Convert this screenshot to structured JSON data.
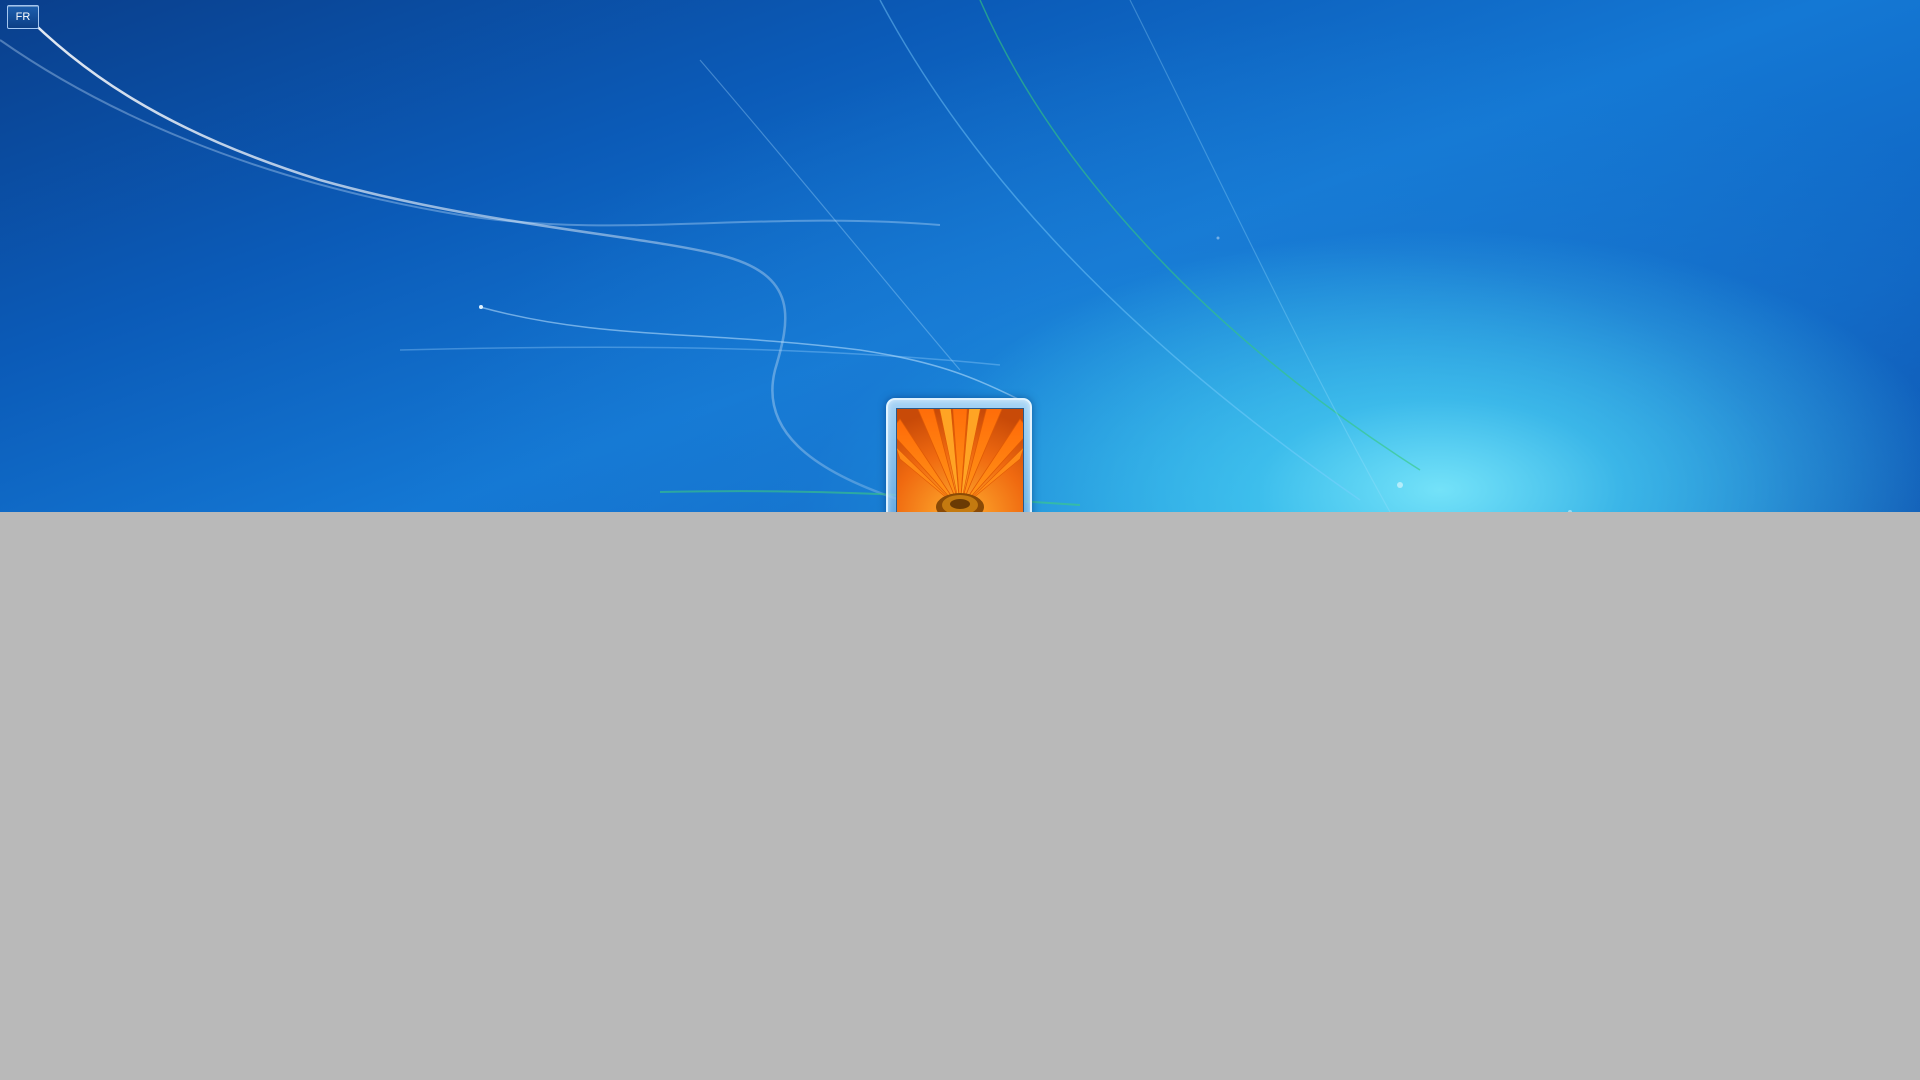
{
  "screen": {
    "type": "windows-logon-screen",
    "wallpaper": "windows-7-blue-swoosh",
    "accent_colors": {
      "wallpaper_dark": "#0a3f8c",
      "wallpaper_mid": "#1478d4",
      "wallpaper_glow": "#78e6fa",
      "overlay_gray": "#b9b9b9"
    }
  },
  "language_indicator": {
    "label": "FR"
  },
  "user_tile": {
    "picture": "orange-gerbera-flower"
  }
}
